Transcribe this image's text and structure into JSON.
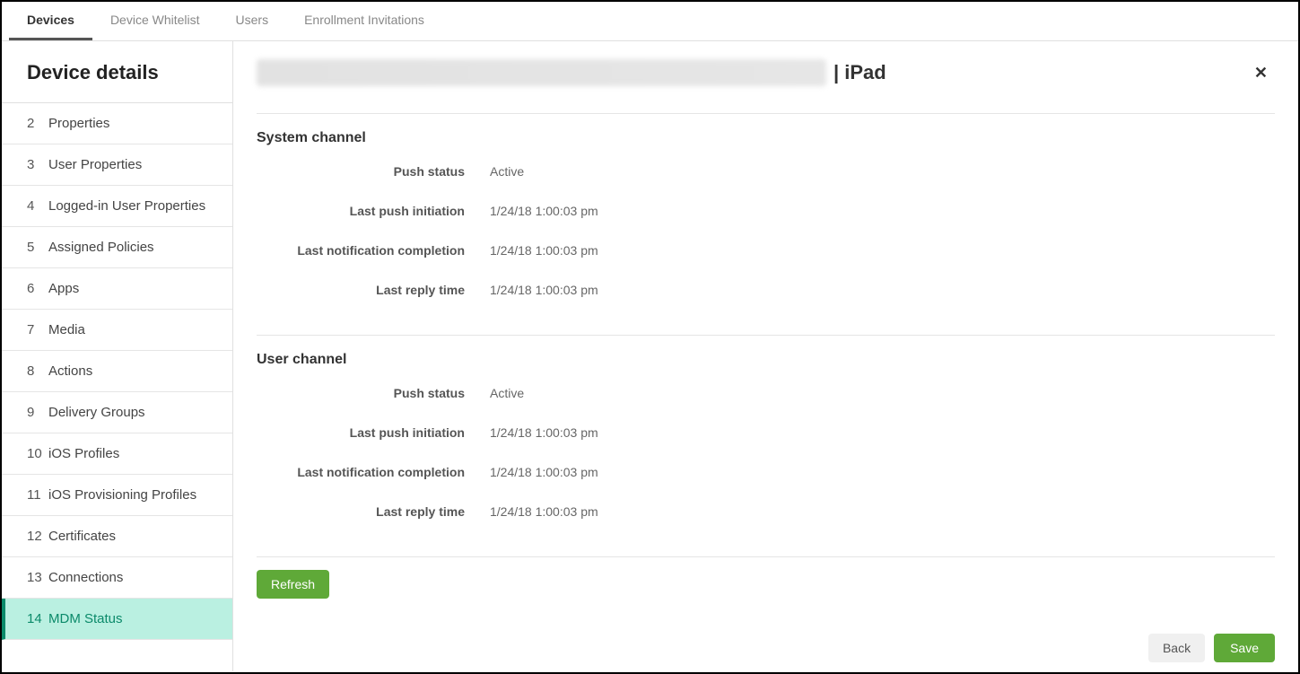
{
  "tabs": {
    "devices": "Devices",
    "whitelist": "Device Whitelist",
    "users": "Users",
    "enrollment": "Enrollment Invitations"
  },
  "sidebar": {
    "title": "Device details",
    "items": [
      {
        "num": "2",
        "label": "Properties"
      },
      {
        "num": "3",
        "label": "User Properties"
      },
      {
        "num": "4",
        "label": "Logged-in User Properties"
      },
      {
        "num": "5",
        "label": "Assigned Policies"
      },
      {
        "num": "6",
        "label": "Apps"
      },
      {
        "num": "7",
        "label": "Media"
      },
      {
        "num": "8",
        "label": "Actions"
      },
      {
        "num": "9",
        "label": "Delivery Groups"
      },
      {
        "num": "10",
        "label": "iOS Profiles"
      },
      {
        "num": "11",
        "label": "iOS Provisioning Profiles"
      },
      {
        "num": "12",
        "label": "Certificates"
      },
      {
        "num": "13",
        "label": "Connections"
      },
      {
        "num": "14",
        "label": "MDM Status"
      }
    ]
  },
  "header": {
    "device_suffix": " | iPad",
    "close": "✕"
  },
  "system_channel": {
    "title": "System channel",
    "rows": {
      "push_status_label": "Push status",
      "push_status_value": "Active",
      "last_push_label": "Last push initiation",
      "last_push_value": "1/24/18 1:00:03 pm",
      "last_notif_label": "Last notification completion",
      "last_notif_value": "1/24/18 1:00:03 pm",
      "last_reply_label": "Last reply time",
      "last_reply_value": "1/24/18 1:00:03 pm"
    }
  },
  "user_channel": {
    "title": "User channel",
    "rows": {
      "push_status_label": "Push status",
      "push_status_value": "Active",
      "last_push_label": "Last push initiation",
      "last_push_value": "1/24/18 1:00:03 pm",
      "last_notif_label": "Last notification completion",
      "last_notif_value": "1/24/18 1:00:03 pm",
      "last_reply_label": "Last reply time",
      "last_reply_value": "1/24/18 1:00:03 pm"
    }
  },
  "buttons": {
    "refresh": "Refresh",
    "back": "Back",
    "save": "Save"
  }
}
